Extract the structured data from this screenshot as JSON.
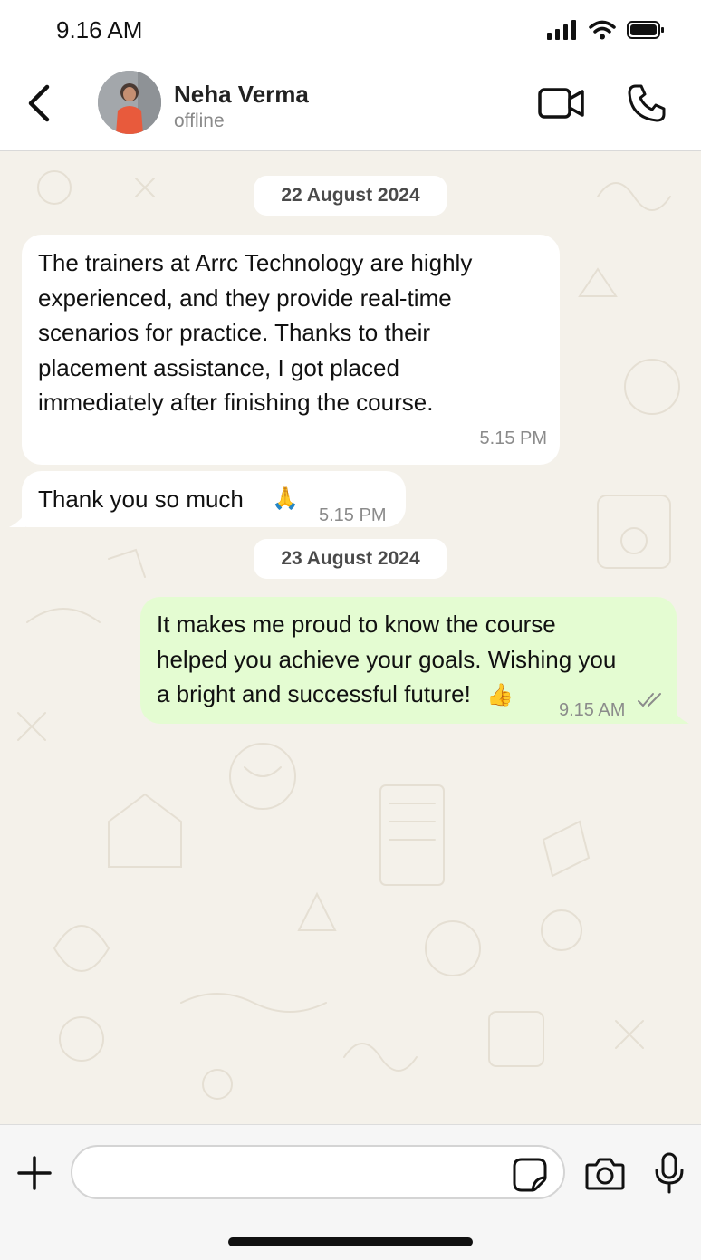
{
  "status_bar": {
    "time": "9.16 AM",
    "icons": [
      "signal-icon",
      "wifi-icon",
      "battery-icon"
    ]
  },
  "header": {
    "contact_name": "Neha Verma",
    "contact_status": "offline",
    "icons": [
      "back-icon",
      "video-call-icon",
      "phone-icon"
    ]
  },
  "chat": {
    "date_1": "22 August 2024",
    "message_1": {
      "lines": [
        "The trainers at Arrc Technology are highly",
        "experienced, and they provide real-time",
        "scenarios for practice. Thanks to their",
        "placement assistance, I got placed",
        "immediately after finishing the course."
      ],
      "time": "5.15 PM"
    },
    "message_2": {
      "text": "Thank you so much",
      "emoji": "🙏",
      "time": "5.15 PM"
    },
    "date_2": "23 August 2024",
    "message_3": {
      "lines": [
        "It makes me proud to know the course",
        "helped you achieve your goals. Wishing you",
        "a bright and successful future!"
      ],
      "emoji": "👍",
      "time": "9.15 AM",
      "read_receipt": "double-check-icon"
    }
  },
  "composer": {
    "value": "",
    "icons": [
      "plus-icon",
      "sticker-icon",
      "camera-icon",
      "microphone-icon"
    ]
  },
  "colors": {
    "chat_background": "#f4f1ea",
    "outgoing_bubble": "#e4fcd2",
    "incoming_bubble": "#ffffff"
  }
}
